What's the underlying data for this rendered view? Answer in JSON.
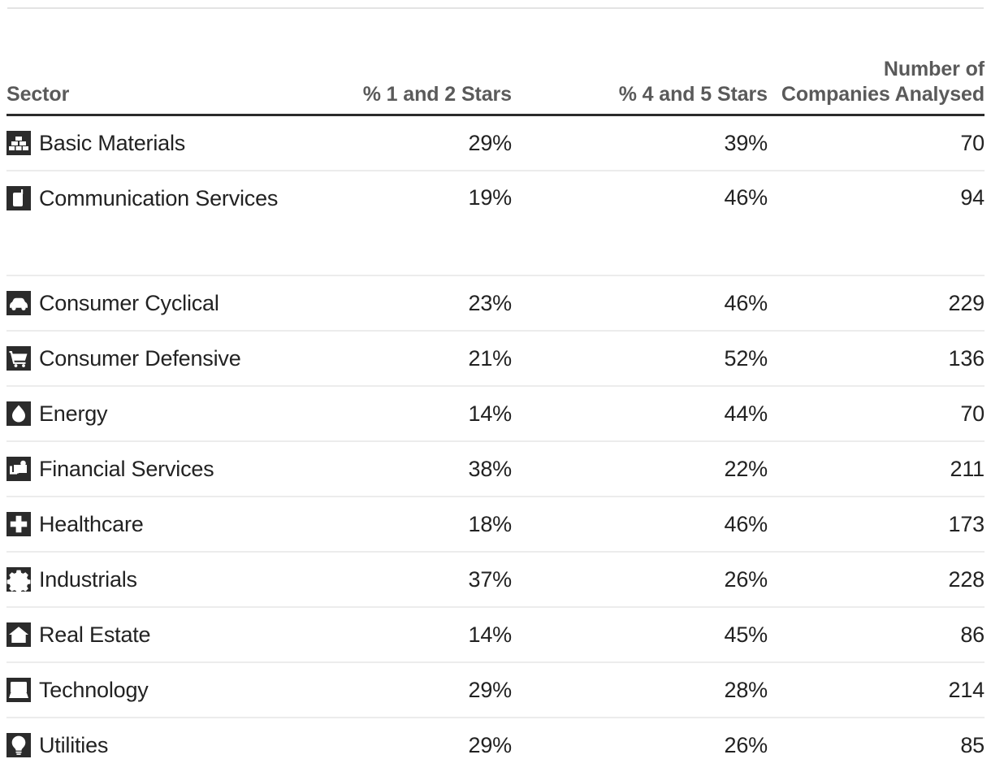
{
  "table": {
    "columns": [
      {
        "key": "sector",
        "label": "Sector",
        "align": "left"
      },
      {
        "key": "low",
        "label": "% 1 and 2 Stars",
        "align": "right"
      },
      {
        "key": "high",
        "label": "% 4 and 5 Stars",
        "align": "right"
      },
      {
        "key": "count",
        "label_line1": "Number of",
        "label_line2": "Companies Analysed",
        "align": "right"
      }
    ],
    "rows": [
      {
        "sector": "Basic Materials",
        "icon": "bricks-icon",
        "low": "29%",
        "high": "39%",
        "count": "70"
      },
      {
        "sector": "Communication Services",
        "icon": "mobile-phone-icon",
        "low": "19%",
        "high": "46%",
        "count": "94"
      },
      {
        "sector": "Consumer Cyclical",
        "icon": "car-icon",
        "low": "23%",
        "high": "46%",
        "count": "229"
      },
      {
        "sector": "Consumer Defensive",
        "icon": "shopping-cart-icon",
        "low": "21%",
        "high": "52%",
        "count": "136"
      },
      {
        "sector": "Energy",
        "icon": "flame-droplet-icon",
        "low": "14%",
        "high": "44%",
        "count": "70"
      },
      {
        "sector": "Financial Services",
        "icon": "bank-money-icon",
        "low": "38%",
        "high": "22%",
        "count": "211"
      },
      {
        "sector": "Healthcare",
        "icon": "medical-cross-icon",
        "low": "18%",
        "high": "46%",
        "count": "173"
      },
      {
        "sector": "Industrials",
        "icon": "gear-icon",
        "low": "37%",
        "high": "26%",
        "count": "228"
      },
      {
        "sector": "Real Estate",
        "icon": "house-icon",
        "low": "14%",
        "high": "45%",
        "count": "86"
      },
      {
        "sector": "Technology",
        "icon": "computer-icon",
        "low": "29%",
        "high": "28%",
        "count": "214"
      },
      {
        "sector": "Utilities",
        "icon": "lightbulb-icon",
        "low": "29%",
        "high": "26%",
        "count": "85"
      }
    ]
  },
  "chart_data": {
    "type": "table",
    "title": "",
    "categories": [
      "Basic Materials",
      "Communication Services",
      "Consumer Cyclical",
      "Consumer Defensive",
      "Energy",
      "Financial Services",
      "Healthcare",
      "Industrials",
      "Real Estate",
      "Technology",
      "Utilities"
    ],
    "series": [
      {
        "name": "% 1 and 2 Stars",
        "values": [
          29,
          19,
          23,
          21,
          14,
          38,
          18,
          37,
          14,
          29,
          29
        ]
      },
      {
        "name": "% 4 and 5 Stars",
        "values": [
          39,
          46,
          46,
          52,
          44,
          22,
          46,
          26,
          45,
          28,
          26
        ]
      },
      {
        "name": "Number of Companies Analysed",
        "values": [
          70,
          94,
          229,
          136,
          70,
          211,
          173,
          228,
          86,
          214,
          85
        ]
      }
    ],
    "xlabel": "Sector",
    "ylabel": ""
  },
  "colors": {
    "header_text": "#5a5a5a",
    "body_text": "#222222",
    "icon_bg": "#2b2b2b",
    "rule_strong": "#2b2b2b",
    "rule_light": "#ececec",
    "rule_top": "#e3e3e3",
    "background": "#ffffff"
  }
}
